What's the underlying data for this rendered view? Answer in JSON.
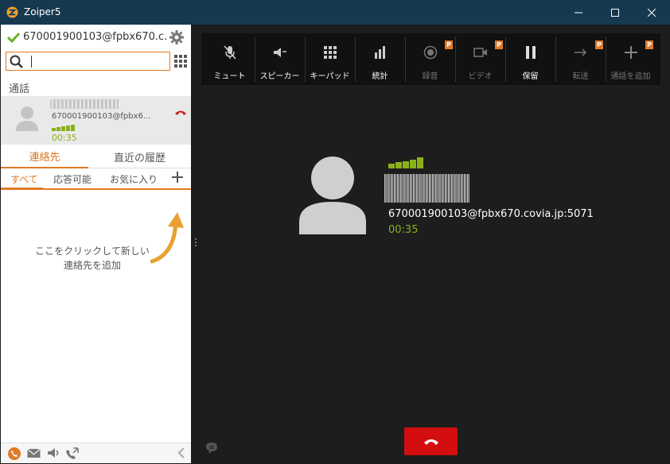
{
  "window": {
    "title": "Zoiper5",
    "icons": [
      "zoiper-logo-icon",
      "minimize-icon",
      "maximize-icon",
      "close-icon"
    ]
  },
  "account": {
    "name": "670001900103@fpbx670.c...",
    "status": "registered"
  },
  "search": {
    "value": "",
    "placeholder": ""
  },
  "calls": {
    "section_label": "通話",
    "active_call": {
      "uri": "670001900103@fpbx6...",
      "duration": "00:35"
    }
  },
  "tabs": [
    {
      "label": "連絡先",
      "active": true
    },
    {
      "label": "直近の履歴",
      "active": false
    }
  ],
  "contact_filters": [
    {
      "label": "すべて",
      "active": true
    },
    {
      "label": "応答可能",
      "active": false
    },
    {
      "label": "お気に入り",
      "active": false
    }
  ],
  "contacts_hint": {
    "line1": "ここをクリックして新しい",
    "line2": "連絡先を追加"
  },
  "toolbar": {
    "mute": "ミュート",
    "speaker": "スピーカー",
    "keypad": "キーパッド",
    "stats": "統計",
    "record": "録音",
    "video": "ビデオ",
    "hold": "保留",
    "transfer": "転送",
    "add_call": "通話を追加",
    "badge": "P"
  },
  "main_call": {
    "uri": "670001900103@fpbx670.covia.jp:5071",
    "duration": "00:35"
  },
  "colors": {
    "accent": "#e07a26",
    "titlebar": "#17394f",
    "signal_green": "#8ab11a",
    "hangup_red": "#d40e0e"
  }
}
